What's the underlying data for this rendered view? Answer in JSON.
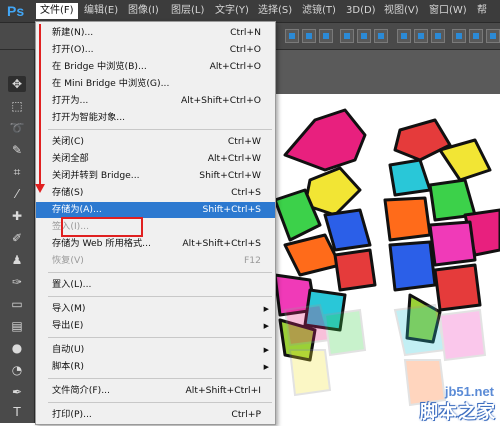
{
  "app": {
    "logo": "Ps"
  },
  "menubar": {
    "items": [
      {
        "label": "文件(F)",
        "active": true
      },
      {
        "label": "编辑(E)"
      },
      {
        "label": "图像(I)"
      },
      {
        "label": "图层(L)"
      },
      {
        "label": "文字(Y)"
      },
      {
        "label": "选择(S)"
      },
      {
        "label": "滤镜(T)"
      },
      {
        "label": "3D(D)"
      },
      {
        "label": "视图(V)"
      },
      {
        "label": "窗口(W)"
      },
      {
        "label": "帮"
      }
    ]
  },
  "file_menu": {
    "items": [
      {
        "label": "新建(N)...",
        "shortcut": "Ctrl+N"
      },
      {
        "label": "打开(O)...",
        "shortcut": "Ctrl+O"
      },
      {
        "label": "在 Bridge 中浏览(B)...",
        "shortcut": "Alt+Ctrl+O"
      },
      {
        "label": "在 Mini Bridge 中浏览(G)...",
        "shortcut": ""
      },
      {
        "label": "打开为...",
        "shortcut": "Alt+Shift+Ctrl+O"
      },
      {
        "label": "打开为智能对象...",
        "shortcut": ""
      },
      {
        "label": "关闭(C)",
        "shortcut": "Ctrl+W"
      },
      {
        "label": "关闭全部",
        "shortcut": "Alt+Ctrl+W"
      },
      {
        "label": "关闭并转到 Bridge...",
        "shortcut": "Shift+Ctrl+W"
      },
      {
        "label": "存储(S)",
        "shortcut": "Ctrl+S"
      },
      {
        "label": "存储为(A)...",
        "shortcut": "Shift+Ctrl+S",
        "highlighted": true
      },
      {
        "label": "签入(I)...",
        "shortcut": "",
        "disabled": true
      },
      {
        "label": "存储为 Web 所用格式...",
        "shortcut": "Alt+Shift+Ctrl+S"
      },
      {
        "label": "恢复(V)",
        "shortcut": "F12"
      },
      {
        "label": "置入(L)...",
        "shortcut": ""
      },
      {
        "label": "导入(M)",
        "shortcut": "",
        "submenu": true
      },
      {
        "label": "导出(E)",
        "shortcut": "",
        "submenu": true
      },
      {
        "label": "自动(U)",
        "shortcut": "",
        "submenu": true
      },
      {
        "label": "脚本(R)",
        "shortcut": "",
        "submenu": true
      },
      {
        "label": "文件简介(F)...",
        "shortcut": "Alt+Shift+Ctrl+I"
      },
      {
        "label": "打印(P)...",
        "shortcut": "Ctrl+P"
      }
    ]
  },
  "watermark": {
    "site": "jb51.net",
    "brand": "脚本之家"
  }
}
